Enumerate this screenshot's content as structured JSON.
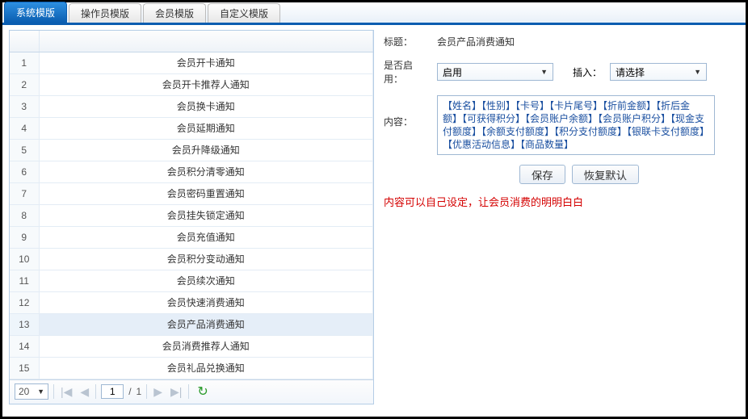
{
  "tabs": {
    "system": "系统模版",
    "operator": "操作员模版",
    "member": "会员模版",
    "custom": "自定义模版"
  },
  "list": {
    "rows": [
      {
        "idx": "1",
        "name": "会员开卡通知"
      },
      {
        "idx": "2",
        "name": "会员开卡推荐人通知"
      },
      {
        "idx": "3",
        "name": "会员换卡通知"
      },
      {
        "idx": "4",
        "name": "会员延期通知"
      },
      {
        "idx": "5",
        "name": "会员升降级通知"
      },
      {
        "idx": "6",
        "name": "会员积分清零通知"
      },
      {
        "idx": "7",
        "name": "会员密码重置通知"
      },
      {
        "idx": "8",
        "name": "会员挂失锁定通知"
      },
      {
        "idx": "9",
        "name": "会员充值通知"
      },
      {
        "idx": "10",
        "name": "会员积分变动通知"
      },
      {
        "idx": "11",
        "name": "会员续次通知"
      },
      {
        "idx": "12",
        "name": "会员快速消费通知"
      },
      {
        "idx": "13",
        "name": "会员产品消费通知"
      },
      {
        "idx": "14",
        "name": "会员消费推荐人通知"
      },
      {
        "idx": "15",
        "name": "会员礼品兑换通知"
      }
    ],
    "selected_index": 12
  },
  "pager": {
    "page_size": "20",
    "page": "1",
    "total_pages": "1",
    "sep": "/"
  },
  "form": {
    "title_label": "标题：",
    "title_value": "会员产品消费通知",
    "enable_label": "是否启用：",
    "enable_value": "启用",
    "insert_label": "插入：",
    "insert_value": "请选择",
    "content_label": "内容：",
    "content_value": "【姓名】【性别】【卡号】【卡片尾号】【折前金额】【折后金额】【可获得积分】【会员账户余额】【会员账户积分】【现金支付额度】【余额支付额度】【积分支付额度】【银联卡支付额度】【优惠活动信息】【商品数量】",
    "save": "保存",
    "restore": "恢复默认"
  },
  "note": "内容可以自己设定，让会员消费的明明白白"
}
